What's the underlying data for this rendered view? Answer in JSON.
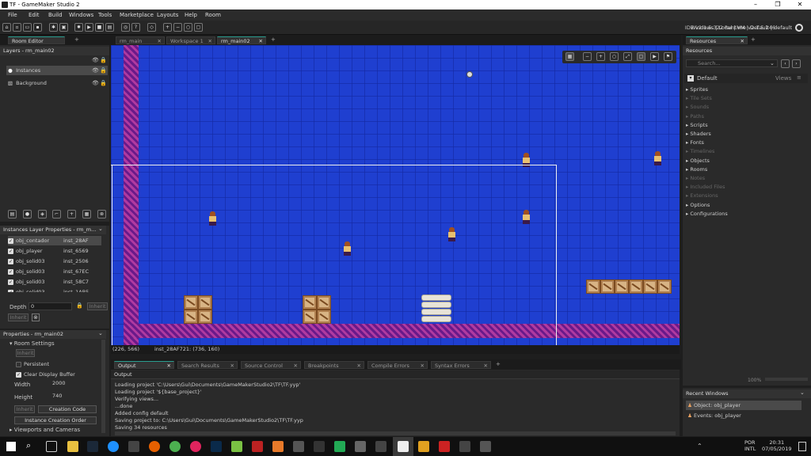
{
  "window": {
    "title": "TF - GameMaker Studio 2",
    "min": "–",
    "max": "❐",
    "close": "✕"
  },
  "menu": [
    "File",
    "Edit",
    "Build",
    "Windows",
    "Tools",
    "Marketplace",
    "Layouts",
    "Help",
    "Room"
  ],
  "ide_info": "IDE v2.1.5.322 Runtime v2.1.5.246",
  "target": {
    "platform": "Windows",
    "sep1": "|",
    "device": "Local",
    "sep2": "|",
    "vm": "VM",
    "sep3": "|",
    "config": "Default",
    "sep4": "|",
    "config2": "default"
  },
  "room_editor": {
    "tab": "Room Editor",
    "layers_title": "Layers - rm_main02",
    "layers": [
      {
        "label": "Instances"
      },
      {
        "label": "Background"
      }
    ],
    "instances_title": "Instances Layer Properties - rm_m...",
    "instances": [
      {
        "name": "obj_contador",
        "id": "inst_28AF"
      },
      {
        "name": "obj_player",
        "id": "inst_6569"
      },
      {
        "name": "obj_solid03",
        "id": "inst_2506"
      },
      {
        "name": "obj_solid03",
        "id": "inst_67EC"
      },
      {
        "name": "obj_solid03",
        "id": "inst_58C7"
      },
      {
        "name": "obj_solid03",
        "id": "inst_1AB5"
      }
    ],
    "depth_label": "Depth",
    "depth_value": "0",
    "inherit": "Inherit",
    "properties_title": "Properties - rm_main02",
    "room_settings": "Room Settings",
    "persistent": "Persistent",
    "clear_display": "Clear Display Buffer",
    "width_label": "Width",
    "width_value": "2000",
    "height_label": "Height",
    "height_value": "740",
    "creation_code": "Creation Code",
    "instance_order": "Instance Creation Order",
    "viewports": "Viewports and Cameras"
  },
  "doc_tabs": [
    {
      "label": "rm_main"
    },
    {
      "label": "Workspace 1"
    },
    {
      "label": "rm_main02"
    }
  ],
  "statusbar": {
    "coords": "(226, 566)",
    "instance": "inst_28AF721: (736, 160)"
  },
  "output_tabs": [
    "Output",
    "Search Results",
    "Source Control",
    "Breakpoints",
    "Compile Errors",
    "Syntax Errors"
  ],
  "output_header": "Output",
  "output_lines": [
    "Loading project 'C:\\Users\\Gui\\Documents\\GameMakerStudio2\\TF\\TF.yyp'",
    "Loading project '${base_project}'",
    "Verifying views...",
    "...done",
    "Added config default",
    "Saving project to: C:\\Users\\Gui\\Documents\\GameMakerStudio2\\TF\\TF.yyp",
    "Saving 34 resources"
  ],
  "resources": {
    "tab": "Resources",
    "header": "Resources",
    "search_placeholder": "Search...",
    "group": "Default",
    "views": "Views",
    "items": [
      {
        "label": "Sprites",
        "enabled": true
      },
      {
        "label": "Tile Sets",
        "enabled": false
      },
      {
        "label": "Sounds",
        "enabled": false
      },
      {
        "label": "Paths",
        "enabled": false
      },
      {
        "label": "Scripts",
        "enabled": true
      },
      {
        "label": "Shaders",
        "enabled": true
      },
      {
        "label": "Fonts",
        "enabled": true
      },
      {
        "label": "Timelines",
        "enabled": false
      },
      {
        "label": "Objects",
        "enabled": true
      },
      {
        "label": "Rooms",
        "enabled": true
      },
      {
        "label": "Notes",
        "enabled": false
      },
      {
        "label": "Included Files",
        "enabled": false
      },
      {
        "label": "Extensions",
        "enabled": false
      },
      {
        "label": "Options",
        "enabled": true
      },
      {
        "label": "Configurations",
        "enabled": true
      }
    ],
    "zoom": "100%"
  },
  "recent_windows": {
    "title": "Recent Windows",
    "items": [
      "Object: obj_player",
      "Events: obj_player"
    ]
  },
  "taskbar": {
    "lang": "POR",
    "kbd": "INTL",
    "time": "20:31",
    "date": "07/05/2019"
  },
  "colors": {
    "room_bg": "#1f3fd0",
    "accent": "#2a9d8f",
    "wall": "#8a2a9a"
  }
}
